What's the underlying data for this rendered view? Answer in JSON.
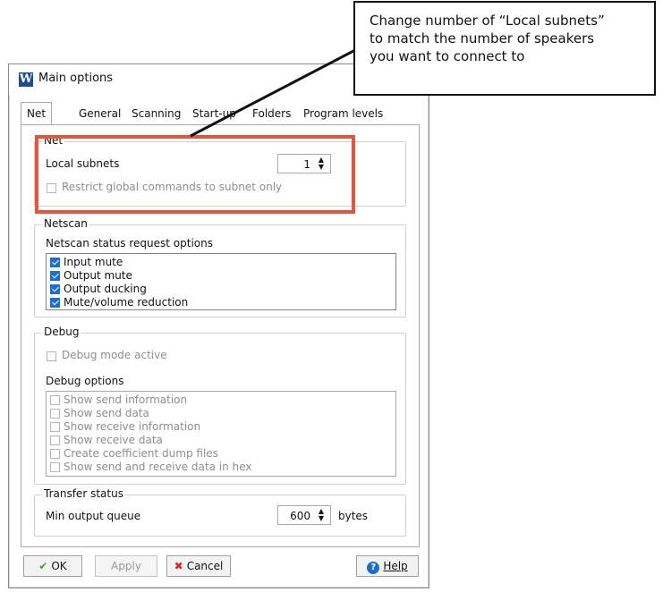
{
  "window": {
    "title": "Main options",
    "icon": "app-w-icon"
  },
  "tabs": [
    "Net",
    "General",
    "Scanning",
    "Start-up",
    "Folders",
    "Program levels"
  ],
  "active_tab": "Net",
  "net_group": {
    "legend": "Net",
    "local_subnets_label": "Local subnets",
    "local_subnets_value": "1",
    "restrict_label": "Restrict global commands to subnet only",
    "restrict_checked": false
  },
  "netscan_group": {
    "legend": "Netscan",
    "options_label": "Netscan status request options",
    "options": [
      {
        "label": "Input mute",
        "checked": true
      },
      {
        "label": "Output mute",
        "checked": true
      },
      {
        "label": "Output ducking",
        "checked": true
      },
      {
        "label": "Mute/volume reduction",
        "checked": true
      }
    ]
  },
  "debug_group": {
    "legend": "Debug",
    "mode_label": "Debug mode active",
    "options_label": "Debug options",
    "options": [
      {
        "label": "Show send information",
        "checked": false
      },
      {
        "label": "Show send data",
        "checked": false
      },
      {
        "label": "Show receive information",
        "checked": false
      },
      {
        "label": "Show receive data",
        "checked": false
      },
      {
        "label": "Create coefficient dump files",
        "checked": false
      },
      {
        "label": "Show send and receive data in hex",
        "checked": false
      }
    ]
  },
  "transfer_group": {
    "legend": "Transfer status",
    "min_queue_label": "Min output queue",
    "min_queue_value": "600",
    "unit": "bytes"
  },
  "buttons": {
    "ok": "OK",
    "apply": "Apply",
    "cancel": "Cancel",
    "help": "Help"
  },
  "annotation": {
    "lines": [
      "Change number of “Local subnets”",
      "to match the number of speakers",
      "you want to connect to"
    ],
    "highlight_color": "#e8533a"
  },
  "colors": {
    "checkbox_on": "#1c6fd1",
    "ok_check": "#3aa13a",
    "cancel_x": "#d22a2a",
    "help_icon": "#1c6fd1"
  }
}
